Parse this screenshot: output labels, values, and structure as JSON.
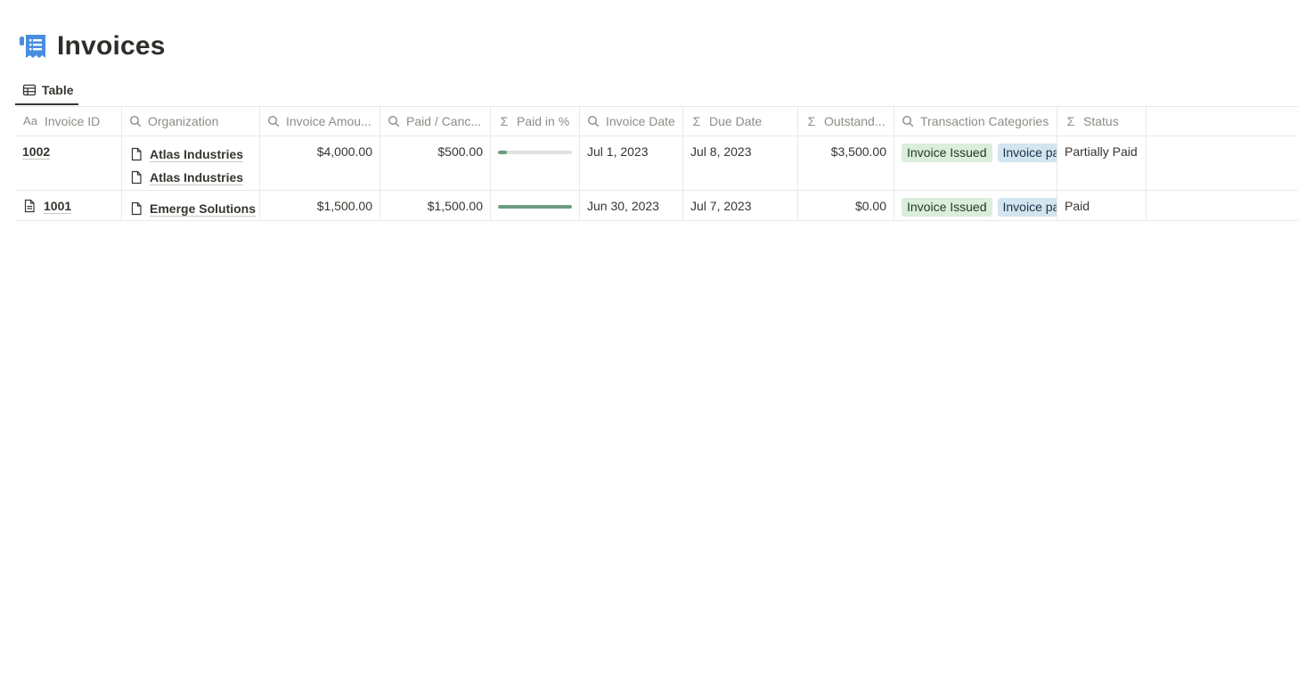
{
  "page": {
    "title": "Invoices",
    "icon": "receipt-icon"
  },
  "views": {
    "active_tab": {
      "label": "Table",
      "icon": "table-icon"
    }
  },
  "columns": [
    {
      "key": "invoice_id",
      "label": "Invoice ID",
      "icon": "title-aa-icon"
    },
    {
      "key": "organization",
      "label": "Organization",
      "icon": "rollup-search-icon"
    },
    {
      "key": "invoice_amount",
      "label": "Invoice Amou...",
      "icon": "rollup-search-icon"
    },
    {
      "key": "paid_cancelled",
      "label": "Paid / Canc...",
      "icon": "rollup-search-icon"
    },
    {
      "key": "paid_pct",
      "label": "Paid in %",
      "icon": "formula-sigma-icon"
    },
    {
      "key": "invoice_date",
      "label": "Invoice Date",
      "icon": "rollup-search-icon"
    },
    {
      "key": "due_date",
      "label": "Due Date",
      "icon": "formula-sigma-icon"
    },
    {
      "key": "outstanding",
      "label": "Outstand...",
      "icon": "formula-sigma-icon"
    },
    {
      "key": "transaction_categories",
      "label": "Transaction Categories",
      "icon": "rollup-search-icon"
    },
    {
      "key": "status",
      "label": "Status",
      "icon": "formula-sigma-icon"
    }
  ],
  "rows": [
    {
      "invoice_id": "1002",
      "organizations": [
        "Atlas Industries",
        "Atlas Industries"
      ],
      "invoice_amount": "$4,000.00",
      "paid_cancelled": "$500.00",
      "paid_pct": 0.125,
      "invoice_date": "Jul 1, 2023",
      "due_date": "Jul 8, 2023",
      "outstanding": "$3,500.00",
      "tags": [
        "Invoice Issued",
        "Invoice pa"
      ],
      "status": "Partially Paid"
    },
    {
      "invoice_id": "1001",
      "organizations": [
        "Emerge Solutions"
      ],
      "invoice_amount": "$1,500.00",
      "paid_cancelled": "$1,500.00",
      "paid_pct": 1.0,
      "invoice_date": "Jun 30, 2023",
      "due_date": "Jul 7, 2023",
      "outstanding": "$0.00",
      "tags": [
        "Invoice Issued",
        "Invoice pa"
      ],
      "status": "Paid"
    }
  ],
  "colors": {
    "progress_fill": "#6c9b7d",
    "tag_green": "#dbeddb",
    "tag_blue": "#d3e5ef",
    "title_icon": "#4a8de0"
  }
}
